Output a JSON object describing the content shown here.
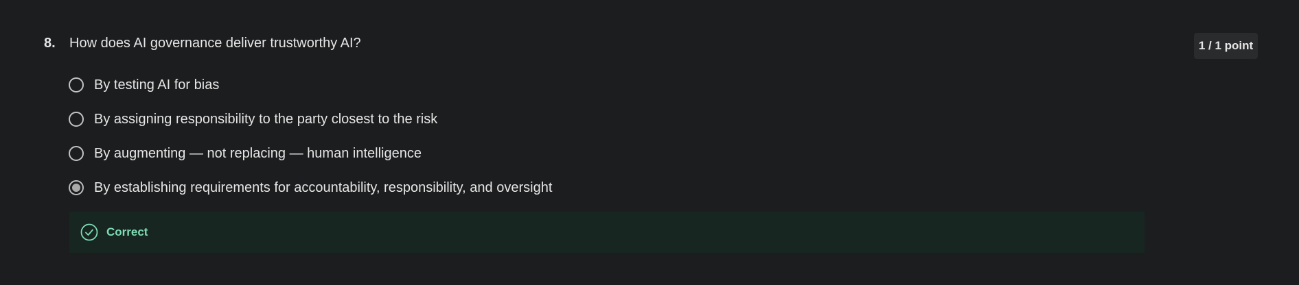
{
  "question": {
    "number": "8.",
    "text": "How does AI governance deliver trustworthy AI?",
    "points": "1 / 1 point"
  },
  "options": [
    {
      "label": "By testing AI for bias",
      "selected": false
    },
    {
      "label": "By assigning responsibility to the party closest to the risk",
      "selected": false
    },
    {
      "label": "By augmenting — not replacing — human intelligence",
      "selected": false
    },
    {
      "label": "By establishing requirements for accountability, responsibility, and oversight",
      "selected": true
    }
  ],
  "feedback": {
    "status": "Correct",
    "icon": "check-circle-icon"
  },
  "colors": {
    "background": "#1c1d1f",
    "feedback_bg": "#172621",
    "correct_accent": "#7fdcb5",
    "badge_bg": "#2a2b2d"
  }
}
